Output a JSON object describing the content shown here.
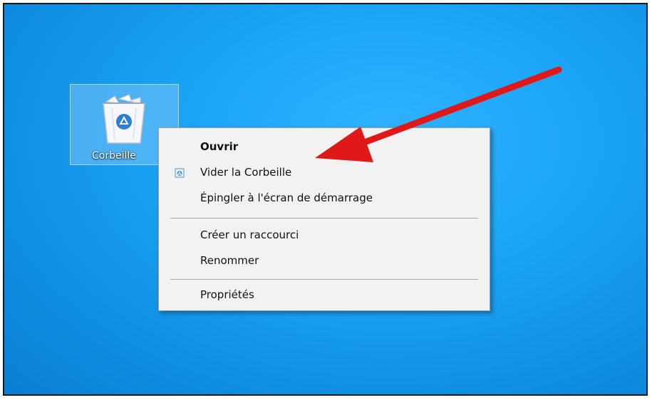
{
  "desktop": {
    "icon_label": "Corbeille",
    "icon_name": "recycle-bin-icon"
  },
  "context_menu": {
    "items": [
      {
        "label": "Ouvrir",
        "bold": true
      },
      {
        "label": "Vider la Corbeille",
        "icon": "recycle-bin-small-icon"
      },
      {
        "label": "Épingler à l'écran de démarrage"
      },
      {
        "label": "Créer un raccourci"
      },
      {
        "label": "Renommer"
      },
      {
        "label": "Propriétés"
      }
    ]
  },
  "annotation": {
    "arrow_color": "#e01818"
  },
  "colors": {
    "desktop_blue": "#1aa3f5",
    "menu_bg": "#f2f2f2"
  }
}
